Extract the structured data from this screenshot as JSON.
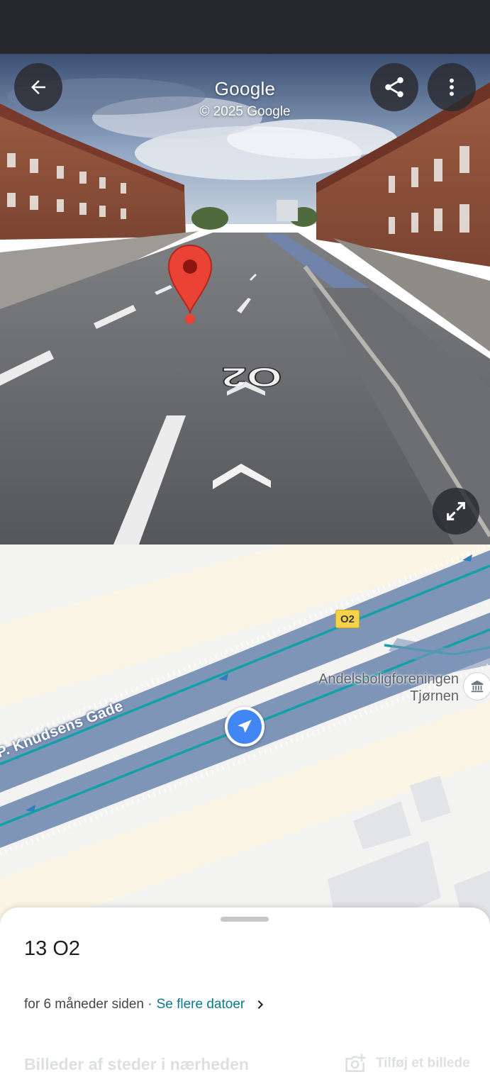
{
  "streetview": {
    "brand": "Google",
    "copyright": "© 2025 Google",
    "road_marking": "O2",
    "buttons": {
      "back": "arrow-left-icon",
      "share": "share-icon",
      "more": "more-vert-icon",
      "expand": "expand-icon"
    }
  },
  "map": {
    "street_name": "P. Knudsens Gade",
    "route_badge": "O2",
    "poi": {
      "line1": "Andelsboligforeningen",
      "line2": "Tjørnen",
      "icon": "building-icon"
    },
    "colors": {
      "road": "#7e95b8",
      "lane": "#14a0a8",
      "background": "#f3f3f2",
      "marker": "#4285f4"
    }
  },
  "sheet": {
    "title": "13 O2",
    "date_text": "for 6 måneder siden · ",
    "date_link": "Se flere datoer",
    "nearby_title": "Billeder af steder i nærheden",
    "add_photo": "Tilføj et billede"
  }
}
